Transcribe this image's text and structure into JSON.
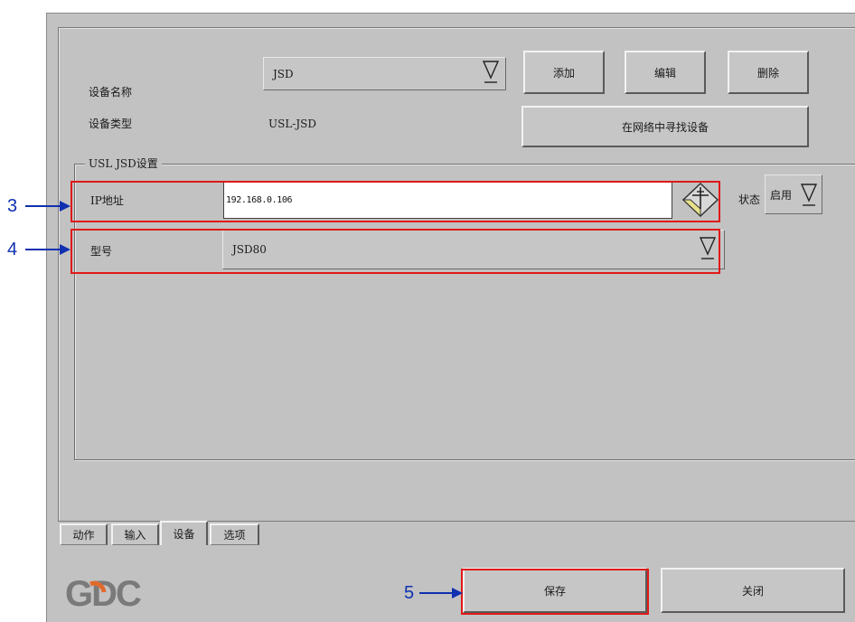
{
  "device": {
    "name_label": "设备名称",
    "name_value": "JSD",
    "type_label": "设备类型",
    "type_value": "USL-JSD",
    "add_label": "添加",
    "edit_label": "编辑",
    "delete_label": "删除",
    "find_label": "在网络中寻找设备"
  },
  "group": {
    "title": "USL JSD设置",
    "ip_label": "IP地址",
    "ip_value": "192.168.0.106",
    "status_label": "状态",
    "status_value": "启用",
    "model_label": "型号",
    "model_value": "JSD80"
  },
  "tabs": [
    {
      "label": "动作"
    },
    {
      "label": "输入"
    },
    {
      "label": "设备",
      "active": true
    },
    {
      "label": "选项"
    }
  ],
  "footer": {
    "logo_text": "GDC",
    "save_label": "保存",
    "close_label": "关闭"
  },
  "callouts": {
    "c3": "3",
    "c4": "4",
    "c5": "5"
  },
  "colors": {
    "window_bg": "#c2c2c2",
    "highlight": "#e01919",
    "callout_blue": "#1030b0",
    "logo_gray": "#7a7a7a",
    "logo_orange": "#e26a2c"
  }
}
